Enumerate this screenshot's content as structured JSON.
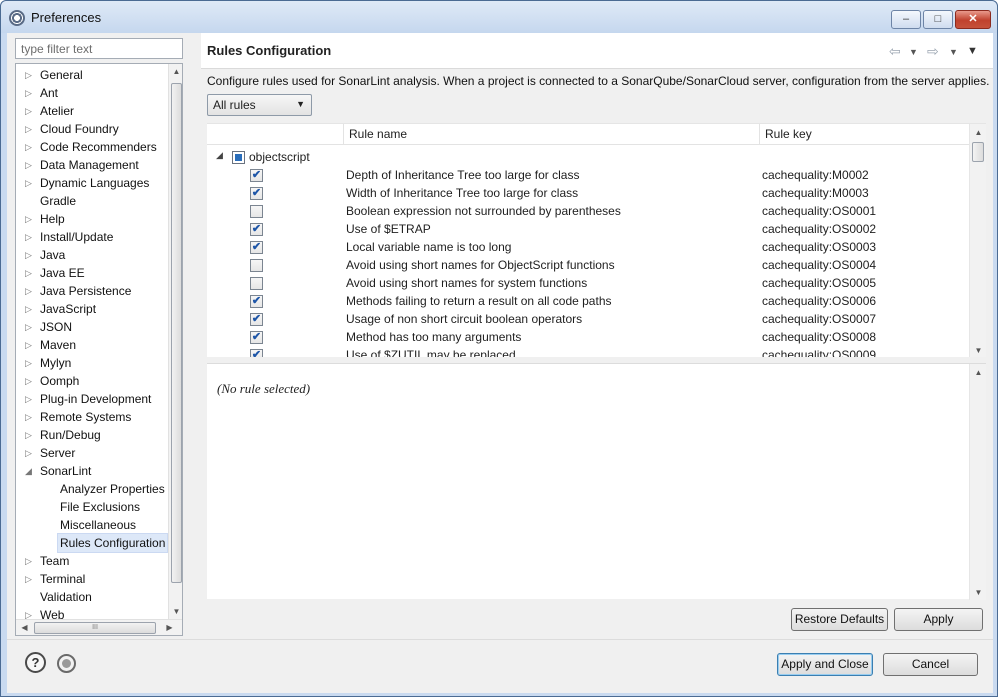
{
  "window": {
    "title": "Preferences",
    "minimize_icon": "minimize-icon",
    "maximize_icon": "maximize-icon",
    "close_icon": "close-icon"
  },
  "sidebar": {
    "filter_placeholder": "type filter text",
    "items": [
      {
        "label": "General",
        "expand": "collapsed",
        "level": 0
      },
      {
        "label": "Ant",
        "expand": "collapsed",
        "level": 0
      },
      {
        "label": "Atelier",
        "expand": "collapsed",
        "level": 0
      },
      {
        "label": "Cloud Foundry",
        "expand": "collapsed",
        "level": 0
      },
      {
        "label": "Code Recommenders",
        "expand": "collapsed",
        "level": 0
      },
      {
        "label": "Data Management",
        "expand": "collapsed",
        "level": 0
      },
      {
        "label": "Dynamic Languages",
        "expand": "collapsed",
        "level": 0
      },
      {
        "label": "Gradle",
        "expand": "none",
        "level": 0
      },
      {
        "label": "Help",
        "expand": "collapsed",
        "level": 0
      },
      {
        "label": "Install/Update",
        "expand": "collapsed",
        "level": 0
      },
      {
        "label": "Java",
        "expand": "collapsed",
        "level": 0
      },
      {
        "label": "Java EE",
        "expand": "collapsed",
        "level": 0
      },
      {
        "label": "Java Persistence",
        "expand": "collapsed",
        "level": 0
      },
      {
        "label": "JavaScript",
        "expand": "collapsed",
        "level": 0
      },
      {
        "label": "JSON",
        "expand": "collapsed",
        "level": 0
      },
      {
        "label": "Maven",
        "expand": "collapsed",
        "level": 0
      },
      {
        "label": "Mylyn",
        "expand": "collapsed",
        "level": 0
      },
      {
        "label": "Oomph",
        "expand": "collapsed",
        "level": 0
      },
      {
        "label": "Plug-in Development",
        "expand": "collapsed",
        "level": 0
      },
      {
        "label": "Remote Systems",
        "expand": "collapsed",
        "level": 0
      },
      {
        "label": "Run/Debug",
        "expand": "collapsed",
        "level": 0
      },
      {
        "label": "Server",
        "expand": "collapsed",
        "level": 0
      },
      {
        "label": "SonarLint",
        "expand": "expanded",
        "level": 0
      },
      {
        "label": "Analyzer Properties",
        "expand": "none",
        "level": 1
      },
      {
        "label": "File Exclusions",
        "expand": "none",
        "level": 1
      },
      {
        "label": "Miscellaneous",
        "expand": "none",
        "level": 1
      },
      {
        "label": "Rules Configuration",
        "expand": "none",
        "level": 1,
        "selected": true
      },
      {
        "label": "Team",
        "expand": "collapsed",
        "level": 0
      },
      {
        "label": "Terminal",
        "expand": "collapsed",
        "level": 0
      },
      {
        "label": "Validation",
        "expand": "none",
        "level": 0
      },
      {
        "label": "Web",
        "expand": "collapsed",
        "level": 0
      }
    ],
    "hscroll_grip": "III"
  },
  "page": {
    "title": "Rules Configuration",
    "description": "Configure rules used for SonarLint analysis. When a project is connected to a SonarQube/SonarCloud server, configuration from the server applies.",
    "filter_combo": "All rules",
    "nav_icons": [
      "back-arrow-icon",
      "back-menu-icon",
      "forward-arrow-icon",
      "forward-menu-icon",
      "view-menu-icon"
    ]
  },
  "table": {
    "columns": [
      "Rule name",
      "Rule key"
    ],
    "group": "objectscript",
    "rows": [
      {
        "name": "Depth of Inheritance Tree too large for class",
        "key": "cachequality:M0002",
        "checked": true
      },
      {
        "name": "Width of Inheritance Tree too large for class",
        "key": "cachequality:M0003",
        "checked": true
      },
      {
        "name": "Boolean expression not surrounded by parentheses",
        "key": "cachequality:OS0001",
        "checked": false
      },
      {
        "name": "Use of $ETRAP",
        "key": "cachequality:OS0002",
        "checked": true
      },
      {
        "name": "Local variable name is too long",
        "key": "cachequality:OS0003",
        "checked": true
      },
      {
        "name": "Avoid using short names for ObjectScript functions",
        "key": "cachequality:OS0004",
        "checked": false
      },
      {
        "name": "Avoid using short names for system functions",
        "key": "cachequality:OS0005",
        "checked": false
      },
      {
        "name": "Methods failing to return a result on all code paths",
        "key": "cachequality:OS0006",
        "checked": true
      },
      {
        "name": "Usage of non short circuit boolean operators",
        "key": "cachequality:OS0007",
        "checked": true
      },
      {
        "name": "Method has too many arguments",
        "key": "cachequality:OS0008",
        "checked": true
      },
      {
        "name": "Use of $ZUTIL may be replaced",
        "key": "cachequality:OS0009",
        "checked": true
      }
    ]
  },
  "details": {
    "empty_message": "(No rule selected)"
  },
  "buttons": {
    "restore_defaults": "Restore Defaults",
    "apply": "Apply",
    "apply_and_close": "Apply and Close",
    "cancel": "Cancel"
  }
}
